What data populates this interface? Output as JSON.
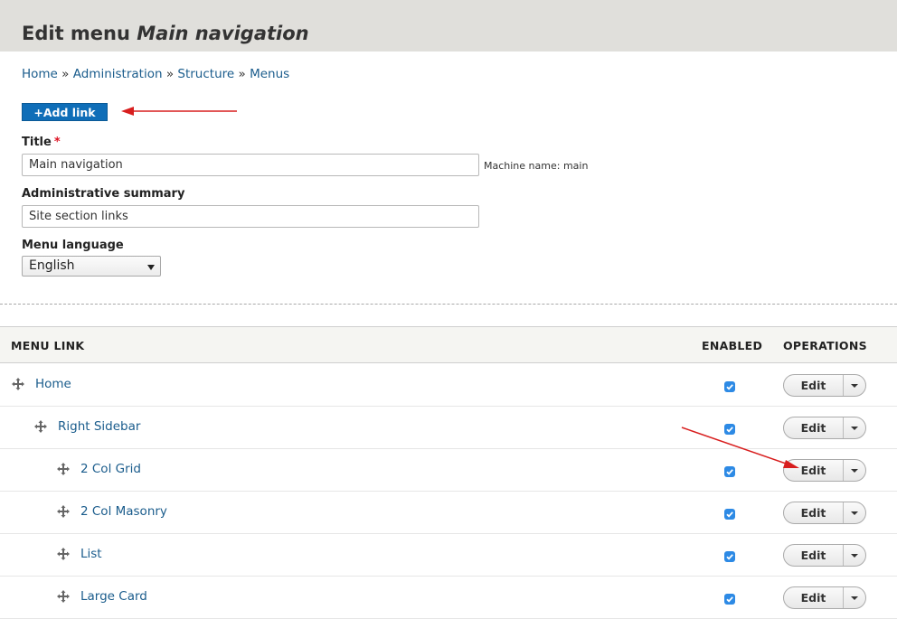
{
  "page": {
    "title_prefix": "Edit menu",
    "title_name": "Main navigation"
  },
  "breadcrumb": [
    {
      "label": "Home"
    },
    {
      "label": "Administration"
    },
    {
      "label": "Structure"
    },
    {
      "label": "Menus"
    }
  ],
  "breadcrumb_separator": "»",
  "actions": {
    "add_link_label": "+Add link"
  },
  "form": {
    "title_label": "Title",
    "title_required_mark": "*",
    "title_value": "Main navigation",
    "machine_name": "Machine name: main",
    "summary_label": "Administrative summary",
    "summary_value": "Site section links",
    "language_label": "Menu language",
    "language_selected": "English"
  },
  "table": {
    "columns": [
      "MENU LINK",
      "ENABLED",
      "OPERATIONS"
    ],
    "rows": [
      {
        "label": "Home",
        "depth": 0,
        "enabled": true,
        "op": "Edit"
      },
      {
        "label": "Right Sidebar",
        "depth": 1,
        "enabled": true,
        "op": "Edit"
      },
      {
        "label": "2 Col Grid",
        "depth": 2,
        "enabled": true,
        "op": "Edit"
      },
      {
        "label": "2 Col Masonry",
        "depth": 2,
        "enabled": true,
        "op": "Edit"
      },
      {
        "label": "List",
        "depth": 2,
        "enabled": true,
        "op": "Edit"
      },
      {
        "label": "Large Card",
        "depth": 2,
        "enabled": true,
        "op": "Edit"
      }
    ]
  },
  "icons": {
    "drag": "move-cross-icon",
    "checkbox": "checkmark-icon",
    "dropdown": "caret-down-icon"
  },
  "colors": {
    "primary_button": "#0f6eb8",
    "link": "#1a5c8c",
    "checkbox": "#2d8ae5",
    "required": "#dd1122",
    "annotation_arrow": "#d81e1e",
    "header_bg": "#e0dfdb"
  }
}
